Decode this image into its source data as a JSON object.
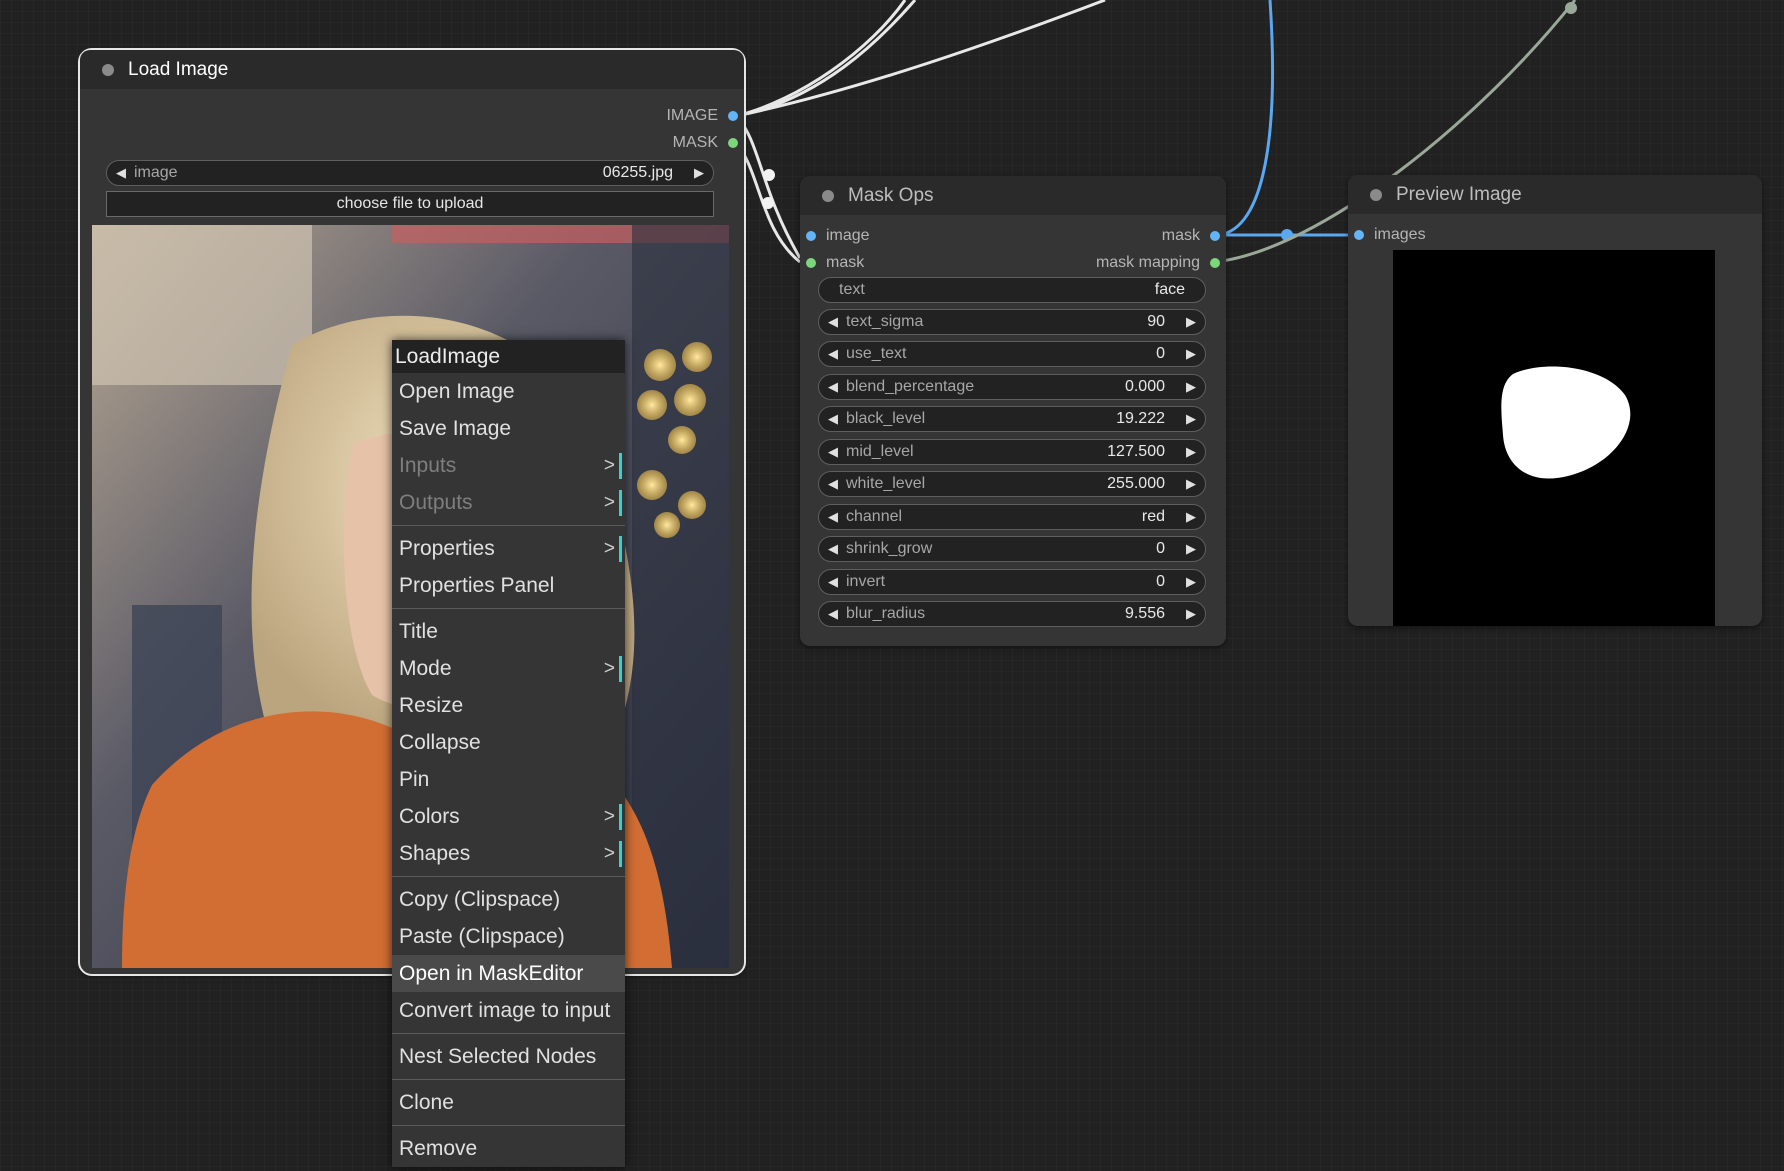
{
  "load_image_node": {
    "title": "Load Image",
    "outputs": [
      "IMAGE",
      "MASK"
    ],
    "image_widget": {
      "label": "image",
      "value": "06255.jpg"
    },
    "upload_button": "choose file to upload"
  },
  "mask_ops_node": {
    "title": "Mask Ops",
    "inputs": [
      "image",
      "mask"
    ],
    "outputs": [
      "mask",
      "mask mapping"
    ],
    "text_widget": {
      "label": "text",
      "value": "face"
    },
    "widgets": [
      {
        "label": "text_sigma",
        "value": "90"
      },
      {
        "label": "use_text",
        "value": "0"
      },
      {
        "label": "blend_percentage",
        "value": "0.000"
      },
      {
        "label": "black_level",
        "value": "19.222"
      },
      {
        "label": "mid_level",
        "value": "127.500"
      },
      {
        "label": "white_level",
        "value": "255.000"
      },
      {
        "label": "channel",
        "value": "red"
      },
      {
        "label": "shrink_grow",
        "value": "0"
      },
      {
        "label": "invert",
        "value": "0"
      },
      {
        "label": "blur_radius",
        "value": "9.556"
      }
    ]
  },
  "preview_node": {
    "title": "Preview Image",
    "inputs": [
      "images"
    ]
  },
  "context_menu": {
    "title": "LoadImage",
    "items": [
      {
        "label": "Open Image"
      },
      {
        "label": "Save Image"
      },
      {
        "label": "Inputs",
        "submenu": true,
        "disabled": true
      },
      {
        "label": "Outputs",
        "submenu": true,
        "disabled": true
      },
      {
        "label": "Properties",
        "submenu": true
      },
      {
        "label": "Properties Panel"
      },
      {
        "label": "Title"
      },
      {
        "label": "Mode",
        "submenu": true
      },
      {
        "label": "Resize"
      },
      {
        "label": "Collapse"
      },
      {
        "label": "Pin"
      },
      {
        "label": "Colors",
        "submenu": true
      },
      {
        "label": "Shapes",
        "submenu": true
      },
      {
        "label": "Copy (Clipspace)"
      },
      {
        "label": "Paste (Clipspace)"
      },
      {
        "label": "Open in MaskEditor",
        "highlighted": true
      },
      {
        "label": "Convert image to input"
      },
      {
        "label": "Nest Selected Nodes"
      },
      {
        "label": "Clone"
      },
      {
        "label": "Remove"
      }
    ],
    "submenu_glyph": ">"
  },
  "colors": {
    "canvas": "#212121",
    "image_slot": "#64b5f6",
    "mask_slot": "#7cd67c",
    "submenu_accent": "#3ad0d0"
  }
}
